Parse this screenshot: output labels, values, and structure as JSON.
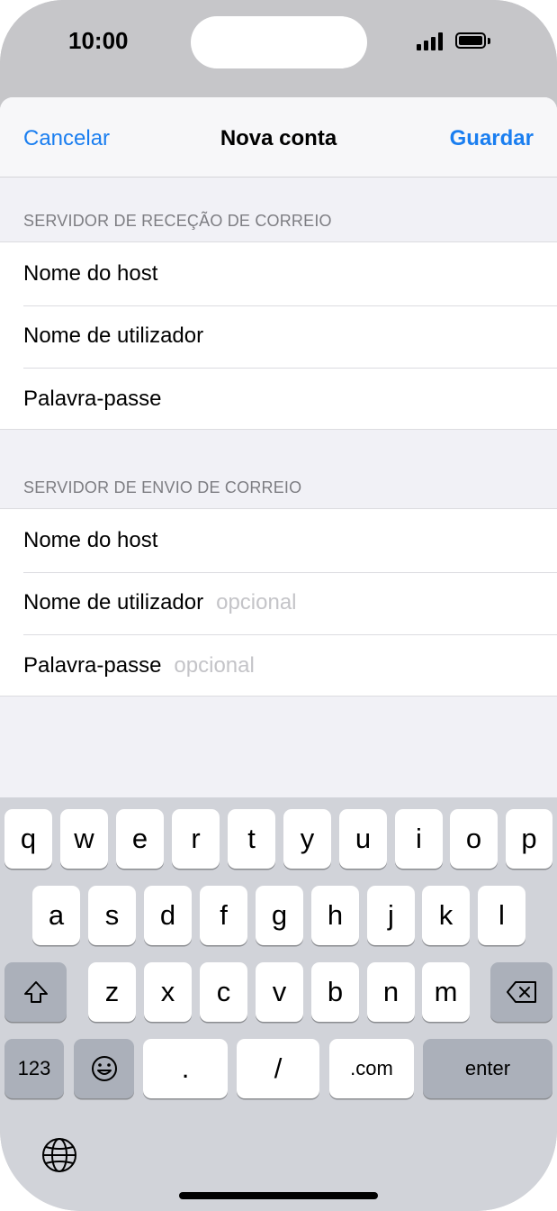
{
  "status": {
    "time": "10:00"
  },
  "nav": {
    "cancel": "Cancelar",
    "title": "Nova conta",
    "save": "Guardar"
  },
  "incoming": {
    "header": "SERVIDOR DE RECEÇÃO DE CORREIO",
    "rows": [
      {
        "label": "Nome do host",
        "placeholder": ""
      },
      {
        "label": "Nome de utilizador",
        "placeholder": ""
      },
      {
        "label": "Palavra-passe",
        "placeholder": ""
      }
    ]
  },
  "outgoing": {
    "header": "SERVIDOR DE ENVIO DE CORREIO",
    "rows": [
      {
        "label": "Nome do host",
        "placeholder": ""
      },
      {
        "label": "Nome de utilizador",
        "placeholder": "opcional"
      },
      {
        "label": "Palavra-passe",
        "placeholder": "opcional"
      }
    ]
  },
  "keyboard": {
    "row1": [
      "q",
      "w",
      "e",
      "r",
      "t",
      "y",
      "u",
      "i",
      "o",
      "p"
    ],
    "row2": [
      "a",
      "s",
      "d",
      "f",
      "g",
      "h",
      "j",
      "k",
      "l"
    ],
    "row3": [
      "z",
      "x",
      "c",
      "v",
      "b",
      "n",
      "m"
    ],
    "numbers": "123",
    "dot": ".",
    "slash": "/",
    "dotcom": ".com",
    "enter": "enter",
    "shift_icon": "shift-icon",
    "delete_icon": "delete-icon",
    "emoji_icon": "emoji-icon",
    "globe_icon": "globe-icon"
  },
  "colors": {
    "accent": "#1a7ef0",
    "placeholder": "#c4c4c8"
  }
}
